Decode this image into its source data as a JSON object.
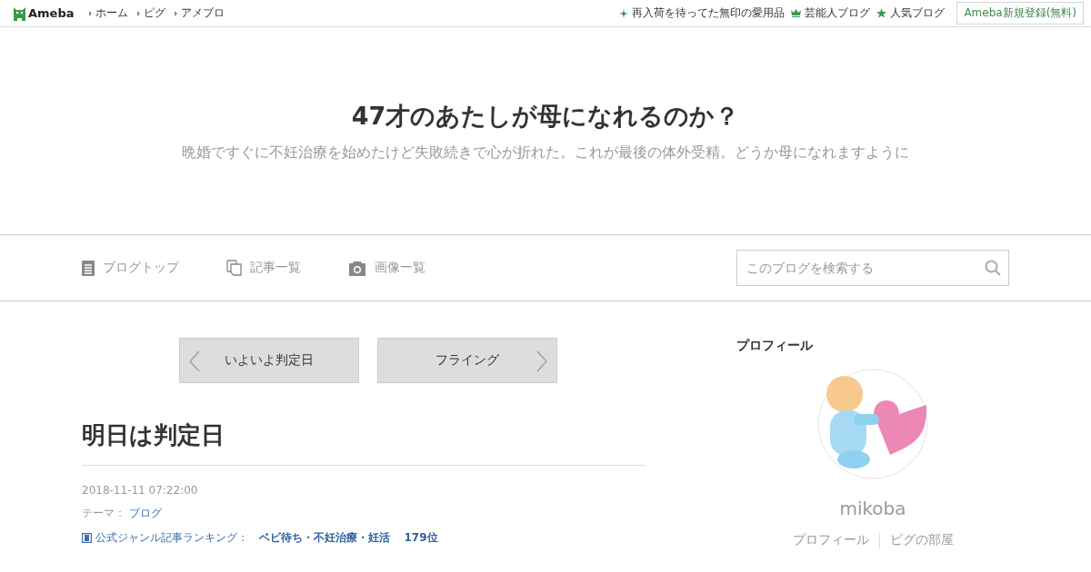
{
  "header": {
    "logo": "Ameba",
    "links": [
      "ホーム",
      "ピグ",
      "アメブロ"
    ],
    "promos": [
      {
        "kind": "sparkle",
        "label": "再入荷を待ってた無印の愛用品"
      },
      {
        "kind": "crown",
        "label": "芸能人ブログ"
      },
      {
        "kind": "star",
        "label": "人気ブログ"
      }
    ],
    "signup": "Ameba新規登録(無料)"
  },
  "blog": {
    "title": "47才のあたしが母になれるのか？",
    "description": "晩婚ですぐに不妊治療を始めたけど失敗続きで心が折れた。これが最後の体外受精。どうか母になれますように"
  },
  "nav": {
    "items": [
      {
        "kind": "top",
        "label": "ブログトップ"
      },
      {
        "kind": "list",
        "label": "記事一覧"
      },
      {
        "kind": "images",
        "label": "画像一覧"
      }
    ],
    "search": {
      "placeholder": "このブログを検索する"
    }
  },
  "pager": {
    "prev": "いよいよ判定日",
    "next": "フライング"
  },
  "article": {
    "title": "明日は判定日",
    "date": "2018-11-11 07:22:00",
    "theme_label": "テーマ：",
    "theme": "ブログ",
    "ranking_label": "公式ジャンル記事ランキング：",
    "ranking_genre": "ベビ待ち・不妊治療・妊活",
    "ranking_rank": "179位"
  },
  "profile": {
    "heading": "プロフィール",
    "name": "mikoba",
    "links": [
      "プロフィール",
      "ピグの部屋"
    ]
  }
}
